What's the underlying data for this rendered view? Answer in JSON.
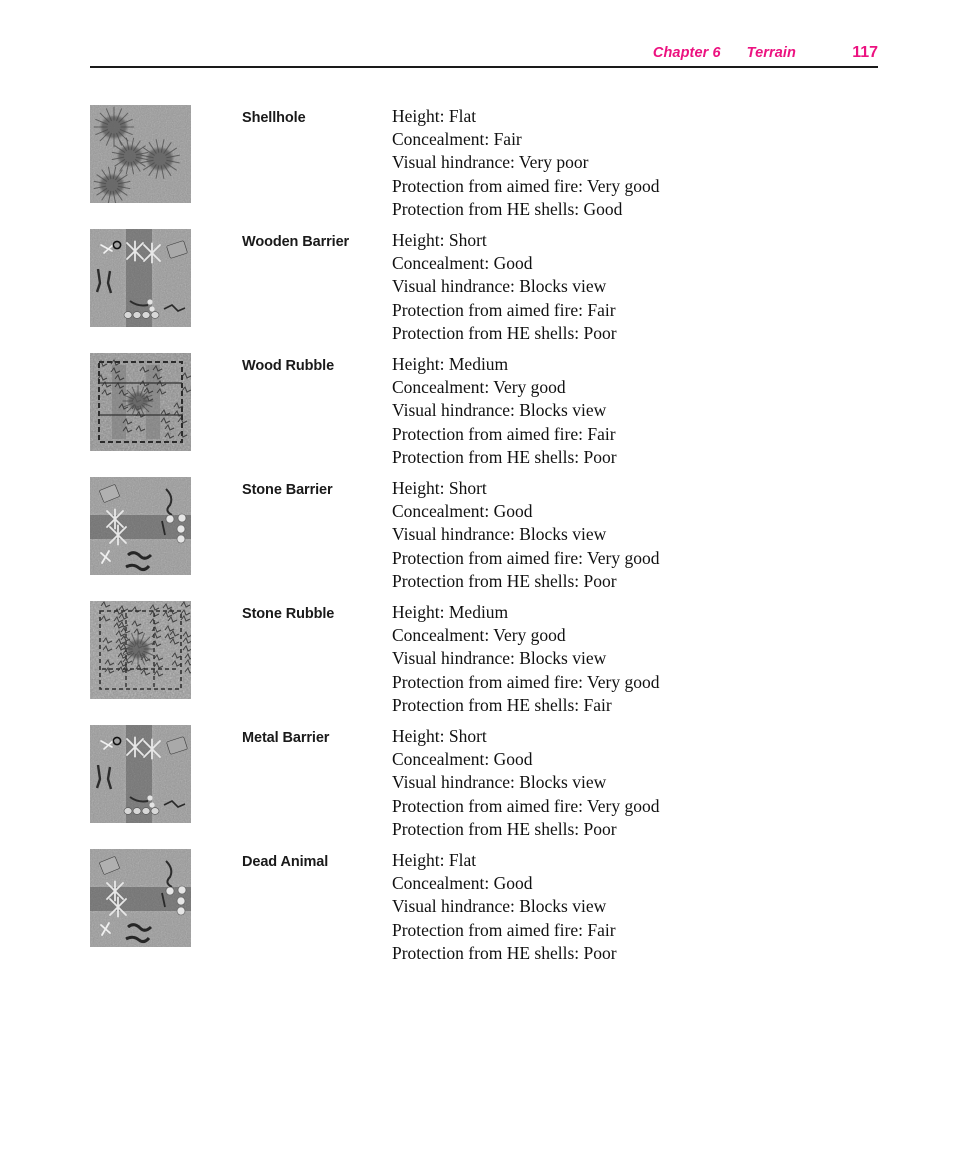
{
  "header": {
    "chapter": "Chapter 6",
    "section": "Terrain",
    "page_number": "117",
    "accent_color": "#ec1280",
    "rule_color": "#1a1a1a"
  },
  "entries": [
    {
      "name": "Shellhole",
      "thumbnail": "shellhole-terrain-thumbnail",
      "attributes": [
        "Height: Flat",
        "Concealment: Fair",
        "Visual hindrance: Very poor",
        "Protection from aimed fire: Very good",
        "Protection from HE shells: Good"
      ]
    },
    {
      "name": "Wooden Barrier",
      "thumbnail": "wooden-barrier-terrain-thumbnail",
      "attributes": [
        "Height: Short",
        "Concealment: Good",
        "Visual hindrance: Blocks view",
        "Protection from aimed fire: Fair",
        "Protection from HE shells: Poor"
      ]
    },
    {
      "name": "Wood Rubble",
      "thumbnail": "wood-rubble-terrain-thumbnail",
      "attributes": [
        "Height: Medium",
        "Concealment: Very good",
        "Visual hindrance: Blocks view",
        "Protection from aimed fire: Fair",
        "Protection from HE shells: Poor"
      ]
    },
    {
      "name": "Stone Barrier",
      "thumbnail": "stone-barrier-terrain-thumbnail",
      "attributes": [
        "Height: Short",
        "Concealment: Good",
        "Visual hindrance: Blocks view",
        "Protection from aimed fire: Very good",
        "Protection from HE shells: Poor"
      ]
    },
    {
      "name": "Stone Rubble",
      "thumbnail": "stone-rubble-terrain-thumbnail",
      "attributes": [
        "Height: Medium",
        "Concealment: Very good",
        "Visual hindrance: Blocks view",
        "Protection from aimed fire: Very good",
        "Protection from HE shells: Fair"
      ]
    },
    {
      "name": "Metal Barrier",
      "thumbnail": "metal-barrier-terrain-thumbnail",
      "attributes": [
        "Height: Short",
        "Concealment: Good",
        "Visual hindrance: Blocks view",
        "Protection from aimed fire: Very good",
        "Protection from HE shells: Poor"
      ]
    },
    {
      "name": "Dead Animal",
      "thumbnail": "dead-animal-terrain-thumbnail",
      "attributes": [
        "Height: Flat",
        "Concealment: Good",
        "Visual hindrance: Blocks view",
        "Protection from aimed fire: Fair",
        "Protection from HE shells: Poor"
      ]
    }
  ]
}
